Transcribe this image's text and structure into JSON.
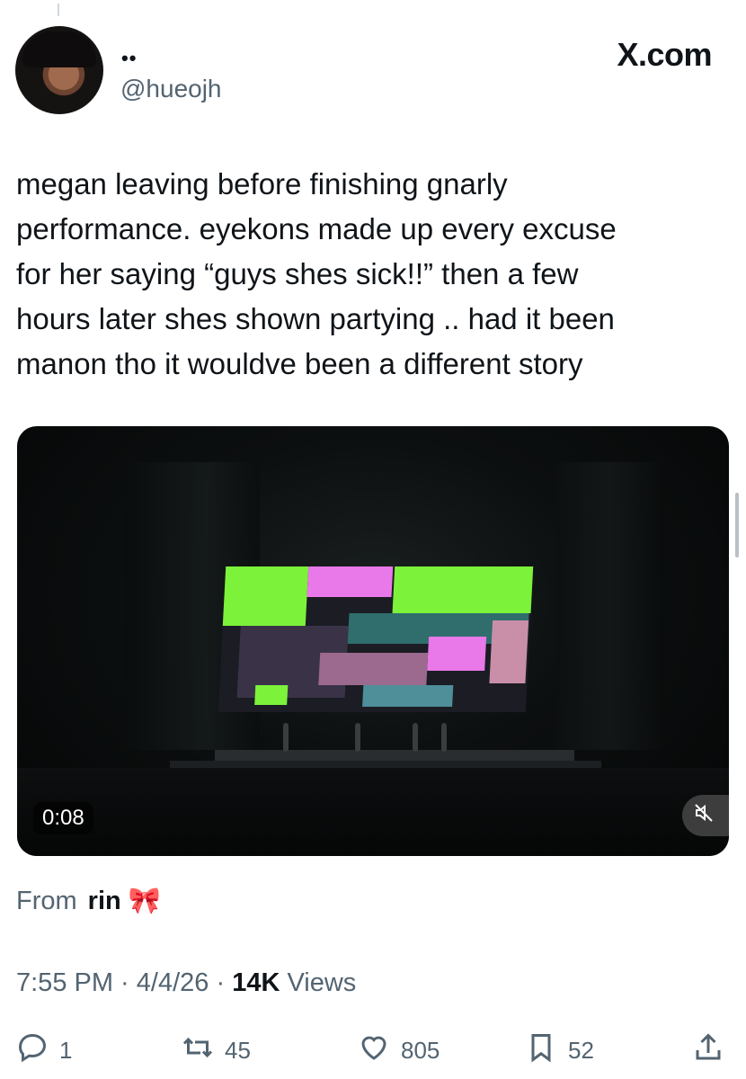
{
  "author": {
    "display_name": "••",
    "handle": "@hueojh",
    "avatar_icon": "profile-photo"
  },
  "brand": "X.com",
  "tweet": {
    "text": "megan leaving before finishing gnarly\nperformance. eyekons made up every excuse\nfor her saying “guys shes sick!!” then a few\nhours later shes shown partying .. had it been\nmanon tho it wouldve been a different story"
  },
  "video": {
    "time": "0:08",
    "mute_icon": "muted-speaker-icon"
  },
  "attribution": {
    "prefix": "From",
    "name": "rin",
    "emoji": "🎀"
  },
  "meta": {
    "time": "7:55 PM",
    "sep1": " · ",
    "date": "4/4/26",
    "sep2": " · ",
    "views_count": "14K",
    "views_label": " Views"
  },
  "actions": {
    "replies": "1",
    "reposts": "45",
    "likes": "805",
    "bookmarks": "52"
  },
  "colors": {
    "text": "#0f1419",
    "secondary": "#536471",
    "screen_green": "#7cf23a",
    "screen_pink": "#e978e8"
  }
}
